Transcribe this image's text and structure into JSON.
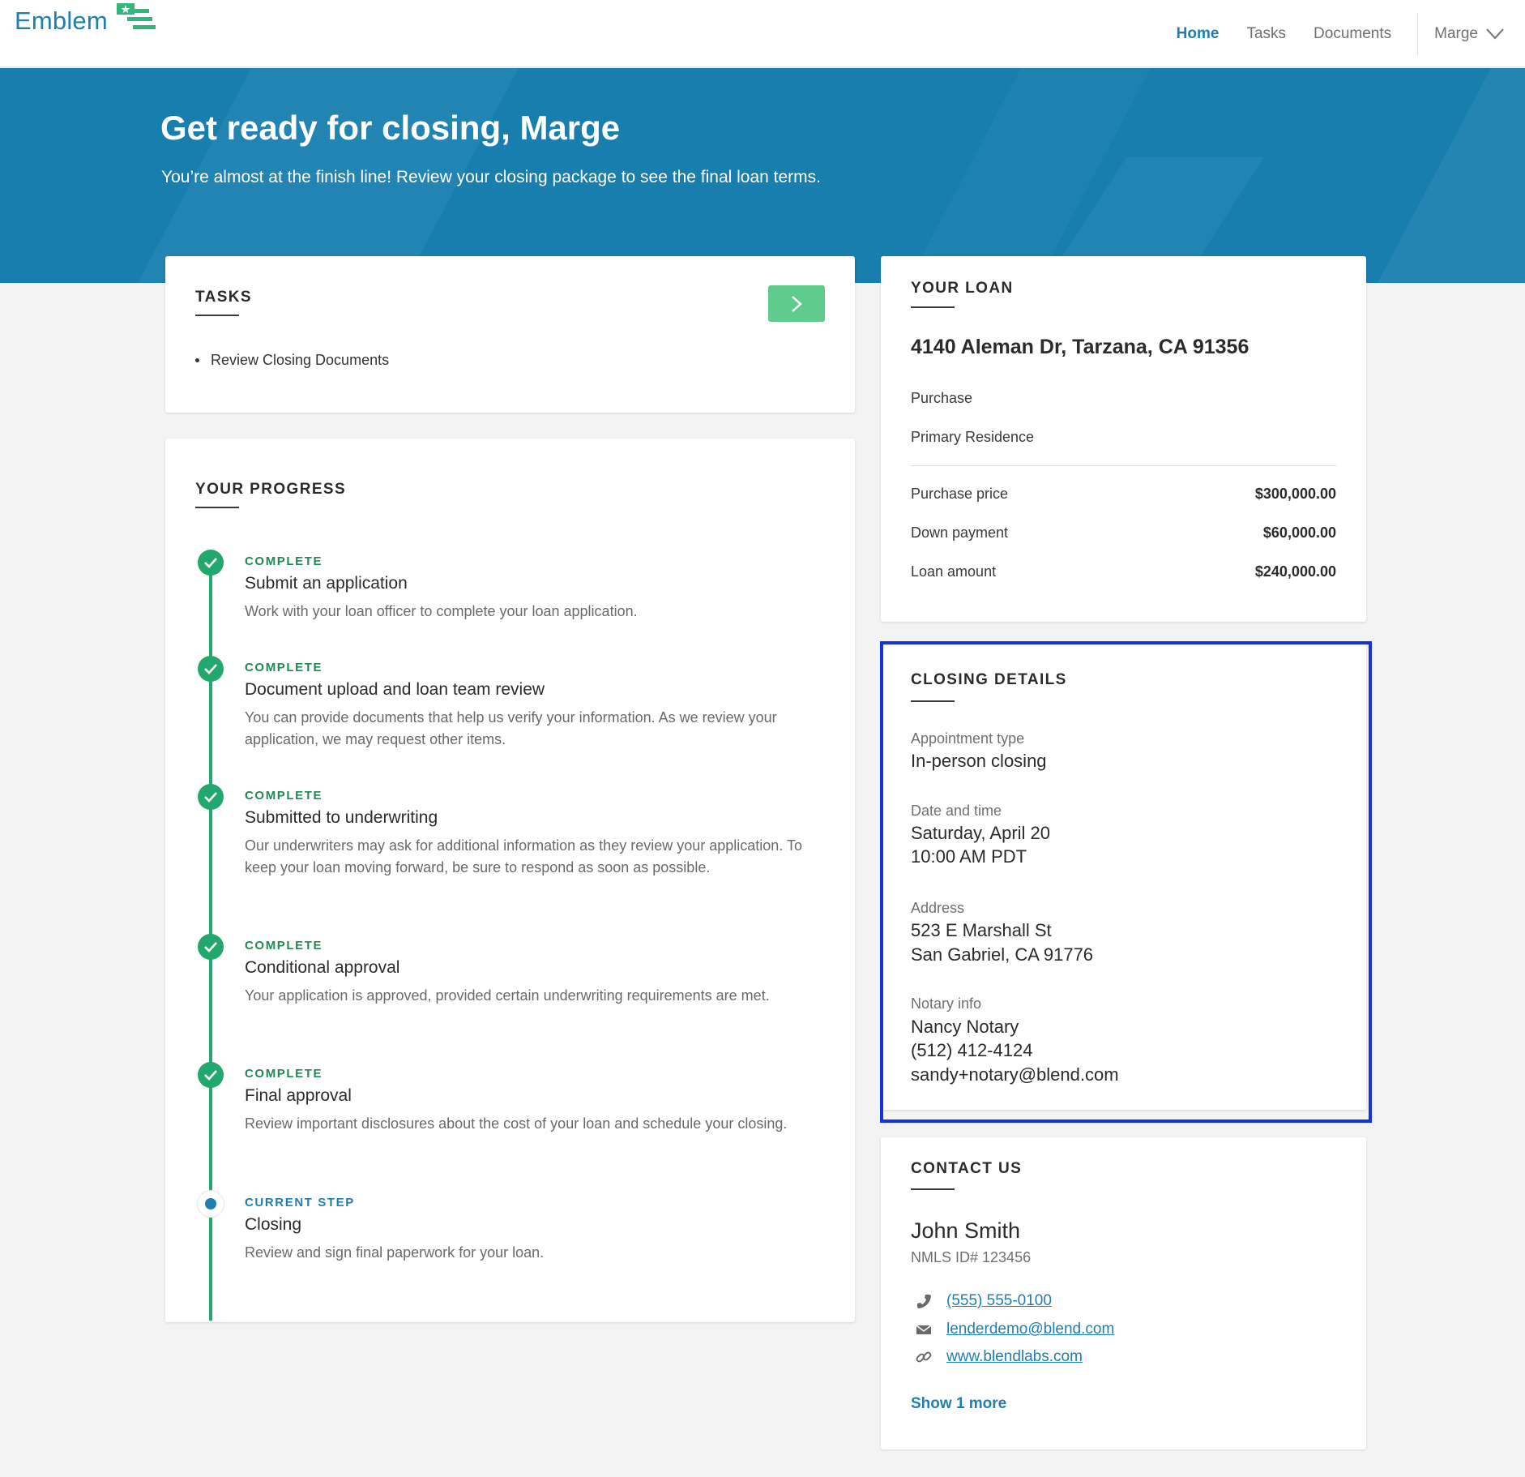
{
  "nav": {
    "logo_text": "Emblem",
    "links": [
      "Home",
      "Tasks",
      "Documents"
    ],
    "active": "Home",
    "user_name": "Marge"
  },
  "hero": {
    "title": "Get ready for closing, Marge",
    "subtitle": "You’re almost at the finish line! Review your closing package to see the final loan terms."
  },
  "tasks": {
    "title": "TASKS",
    "items": [
      "Review Closing Documents"
    ]
  },
  "progress": {
    "title": "YOUR PROGRESS",
    "steps": [
      {
        "status": "COMPLETE",
        "title": "Submit an application",
        "desc": "Work with your loan officer to complete your loan application."
      },
      {
        "status": "COMPLETE",
        "title": "Document upload and loan team review",
        "desc": "You can provide documents that help us verify your information. As we review your application, we may request other items."
      },
      {
        "status": "COMPLETE",
        "title": "Submitted to underwriting",
        "desc": "Our underwriters may ask for additional information as they review your application. To keep your loan moving forward, be sure to respond as soon as possible."
      },
      {
        "status": "COMPLETE",
        "title": "Conditional approval",
        "desc": "Your application is approved, provided certain underwriting requirements are met."
      },
      {
        "status": "COMPLETE",
        "title": "Final approval",
        "desc": "Review important disclosures about the cost of your loan and schedule your closing."
      },
      {
        "status": "CURRENT STEP",
        "title": "Closing",
        "desc": "Review and sign final paperwork for your loan."
      }
    ]
  },
  "loan": {
    "title": "YOUR LOAN",
    "address": "4140 Aleman Dr, Tarzana, CA 91356",
    "purpose": "Purchase",
    "occupancy": "Primary Residence",
    "rows": [
      {
        "label": "Purchase price",
        "value": "$300,000.00"
      },
      {
        "label": "Down payment",
        "value": "$60,000.00"
      },
      {
        "label": "Loan amount",
        "value": "$240,000.00"
      }
    ]
  },
  "closing": {
    "title": "CLOSING DETAILS",
    "appointment_label": "Appointment type",
    "appointment_value": "In-person closing",
    "datetime_label": "Date and time",
    "date": "Saturday, April 20",
    "time": "10:00 AM PDT",
    "address_label": "Address",
    "address_line1": "523 E Marshall St",
    "address_line2": "San Gabriel, CA 91776",
    "notary_label": "Notary info",
    "notary_name": "Nancy Notary",
    "notary_phone": "(512) 412-4124",
    "notary_email": "sandy+notary@blend.com"
  },
  "contact": {
    "title": "CONTACT US",
    "name": "John Smith",
    "nmls": "NMLS ID# 123456",
    "phone": "(555) 555-0100",
    "email": "lenderdemo@blend.com",
    "website": "www.blendlabs.com",
    "show_more": "Show 1 more"
  },
  "colors": {
    "brand_blue": "#177eae",
    "link_blue": "#1f7fb0",
    "success_green": "#22a86d",
    "button_green": "#5fcb8c",
    "highlight_border": "#1333e0"
  },
  "icons": [
    "logo-flag-icon",
    "chevron-down-icon",
    "chevron-right-icon",
    "check-icon",
    "phone-icon",
    "mail-icon",
    "link-icon"
  ]
}
